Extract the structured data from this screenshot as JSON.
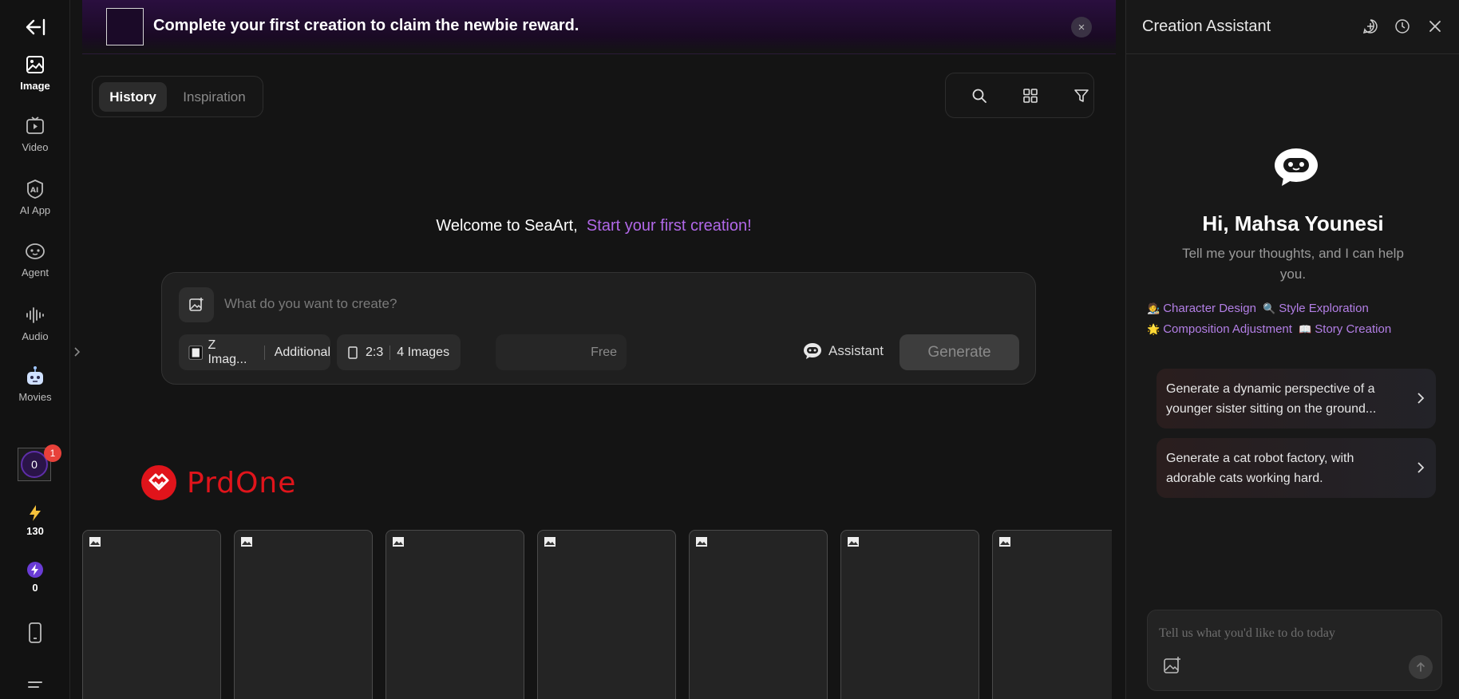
{
  "banner": {
    "text": "Complete your first creation to claim the newbie reward.",
    "close_symbol": "×"
  },
  "nav": {
    "items": [
      {
        "label": "Image",
        "icon": "image-icon"
      },
      {
        "label": "Video",
        "icon": "video-icon"
      },
      {
        "label": "AI App",
        "icon": "ai-app-icon"
      },
      {
        "label": "Agent",
        "icon": "agent-icon"
      },
      {
        "label": "Audio",
        "icon": "audio-icon"
      },
      {
        "label": "Movies",
        "icon": "movies-icon"
      }
    ],
    "avatar_value": "0",
    "notification_count": "1",
    "energy": "130",
    "stamina": "0"
  },
  "tabs": {
    "history": "History",
    "inspiration": "Inspiration"
  },
  "welcome": {
    "text": "Welcome to SeaArt,",
    "accent": "Start your first creation!"
  },
  "prompt": {
    "placeholder": "What do you want to create?",
    "model": "Z Imag...",
    "additional": "Additional",
    "ratio": "2:3",
    "count": "4 Images",
    "cost": "Free",
    "assistant": "Assistant",
    "generate": "Generate"
  },
  "logo": {
    "text": "PrdOne"
  },
  "assistant_panel": {
    "title": "Creation Assistant",
    "greeting": "Hi, Mahsa Younesi",
    "subtitle": "Tell me your thoughts, and I can help you.",
    "tags": [
      {
        "emoji": "🧑‍🎨",
        "label": "Character Design"
      },
      {
        "emoji": "🔍",
        "label": "Style Exploration"
      },
      {
        "emoji": "🌟",
        "label": "Composition Adjustment"
      },
      {
        "emoji": "📖",
        "label": "Story Creation"
      }
    ],
    "suggestions": [
      "Generate a dynamic perspective of a younger sister sitting on the ground...",
      "Generate a cat robot factory, with adorable cats working hard."
    ],
    "input_placeholder": "Tell us what you'd like to do today"
  },
  "colors": {
    "accent": "#b168e8",
    "badge": "#e8413a",
    "logo_red": "#e0141b"
  }
}
